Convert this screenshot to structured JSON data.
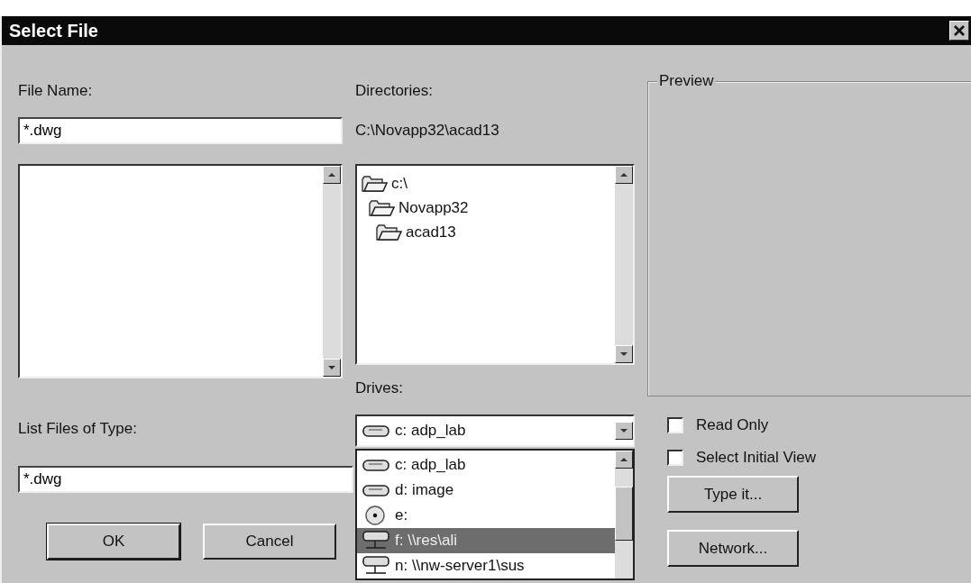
{
  "window": {
    "title": "Select File"
  },
  "file_name": {
    "label": "File Name:",
    "value": "*.dwg"
  },
  "directories": {
    "label": "Directories:",
    "path": "C:\\Novapp32\\acad13",
    "tree": [
      {
        "label": "c:\\",
        "children": [
          {
            "label": "Novapp32",
            "children": [
              {
                "label": "acad13"
              }
            ]
          }
        ]
      }
    ]
  },
  "drives": {
    "label": "Drives:",
    "value": {
      "label": "c: adp_lab",
      "kind": "hdd"
    },
    "expanded": true,
    "options": [
      {
        "label": "c: adp_lab",
        "kind": "hdd",
        "selected": false
      },
      {
        "label": "d: image",
        "kind": "hdd",
        "selected": false
      },
      {
        "label": "e:",
        "kind": "cdrom",
        "selected": false
      },
      {
        "label": "f: \\\\res\\ali",
        "kind": "network",
        "selected": true
      },
      {
        "label": "n: \\\\nw-server1\\sus",
        "kind": "network",
        "selected": false
      }
    ]
  },
  "file_type": {
    "label": "List Files of Type:",
    "value": "*.dwg"
  },
  "buttons": [
    {
      "label": "OK",
      "default": true
    },
    {
      "label": "Cancel",
      "default": false
    }
  ],
  "preview": {
    "title": "Preview"
  },
  "checkboxes": [
    {
      "label": "Read Only",
      "checked": false
    },
    {
      "label": "Select Initial View",
      "checked": false
    }
  ],
  "side_buttons": [
    {
      "label": "Type it..."
    },
    {
      "label": "Network..."
    }
  ]
}
